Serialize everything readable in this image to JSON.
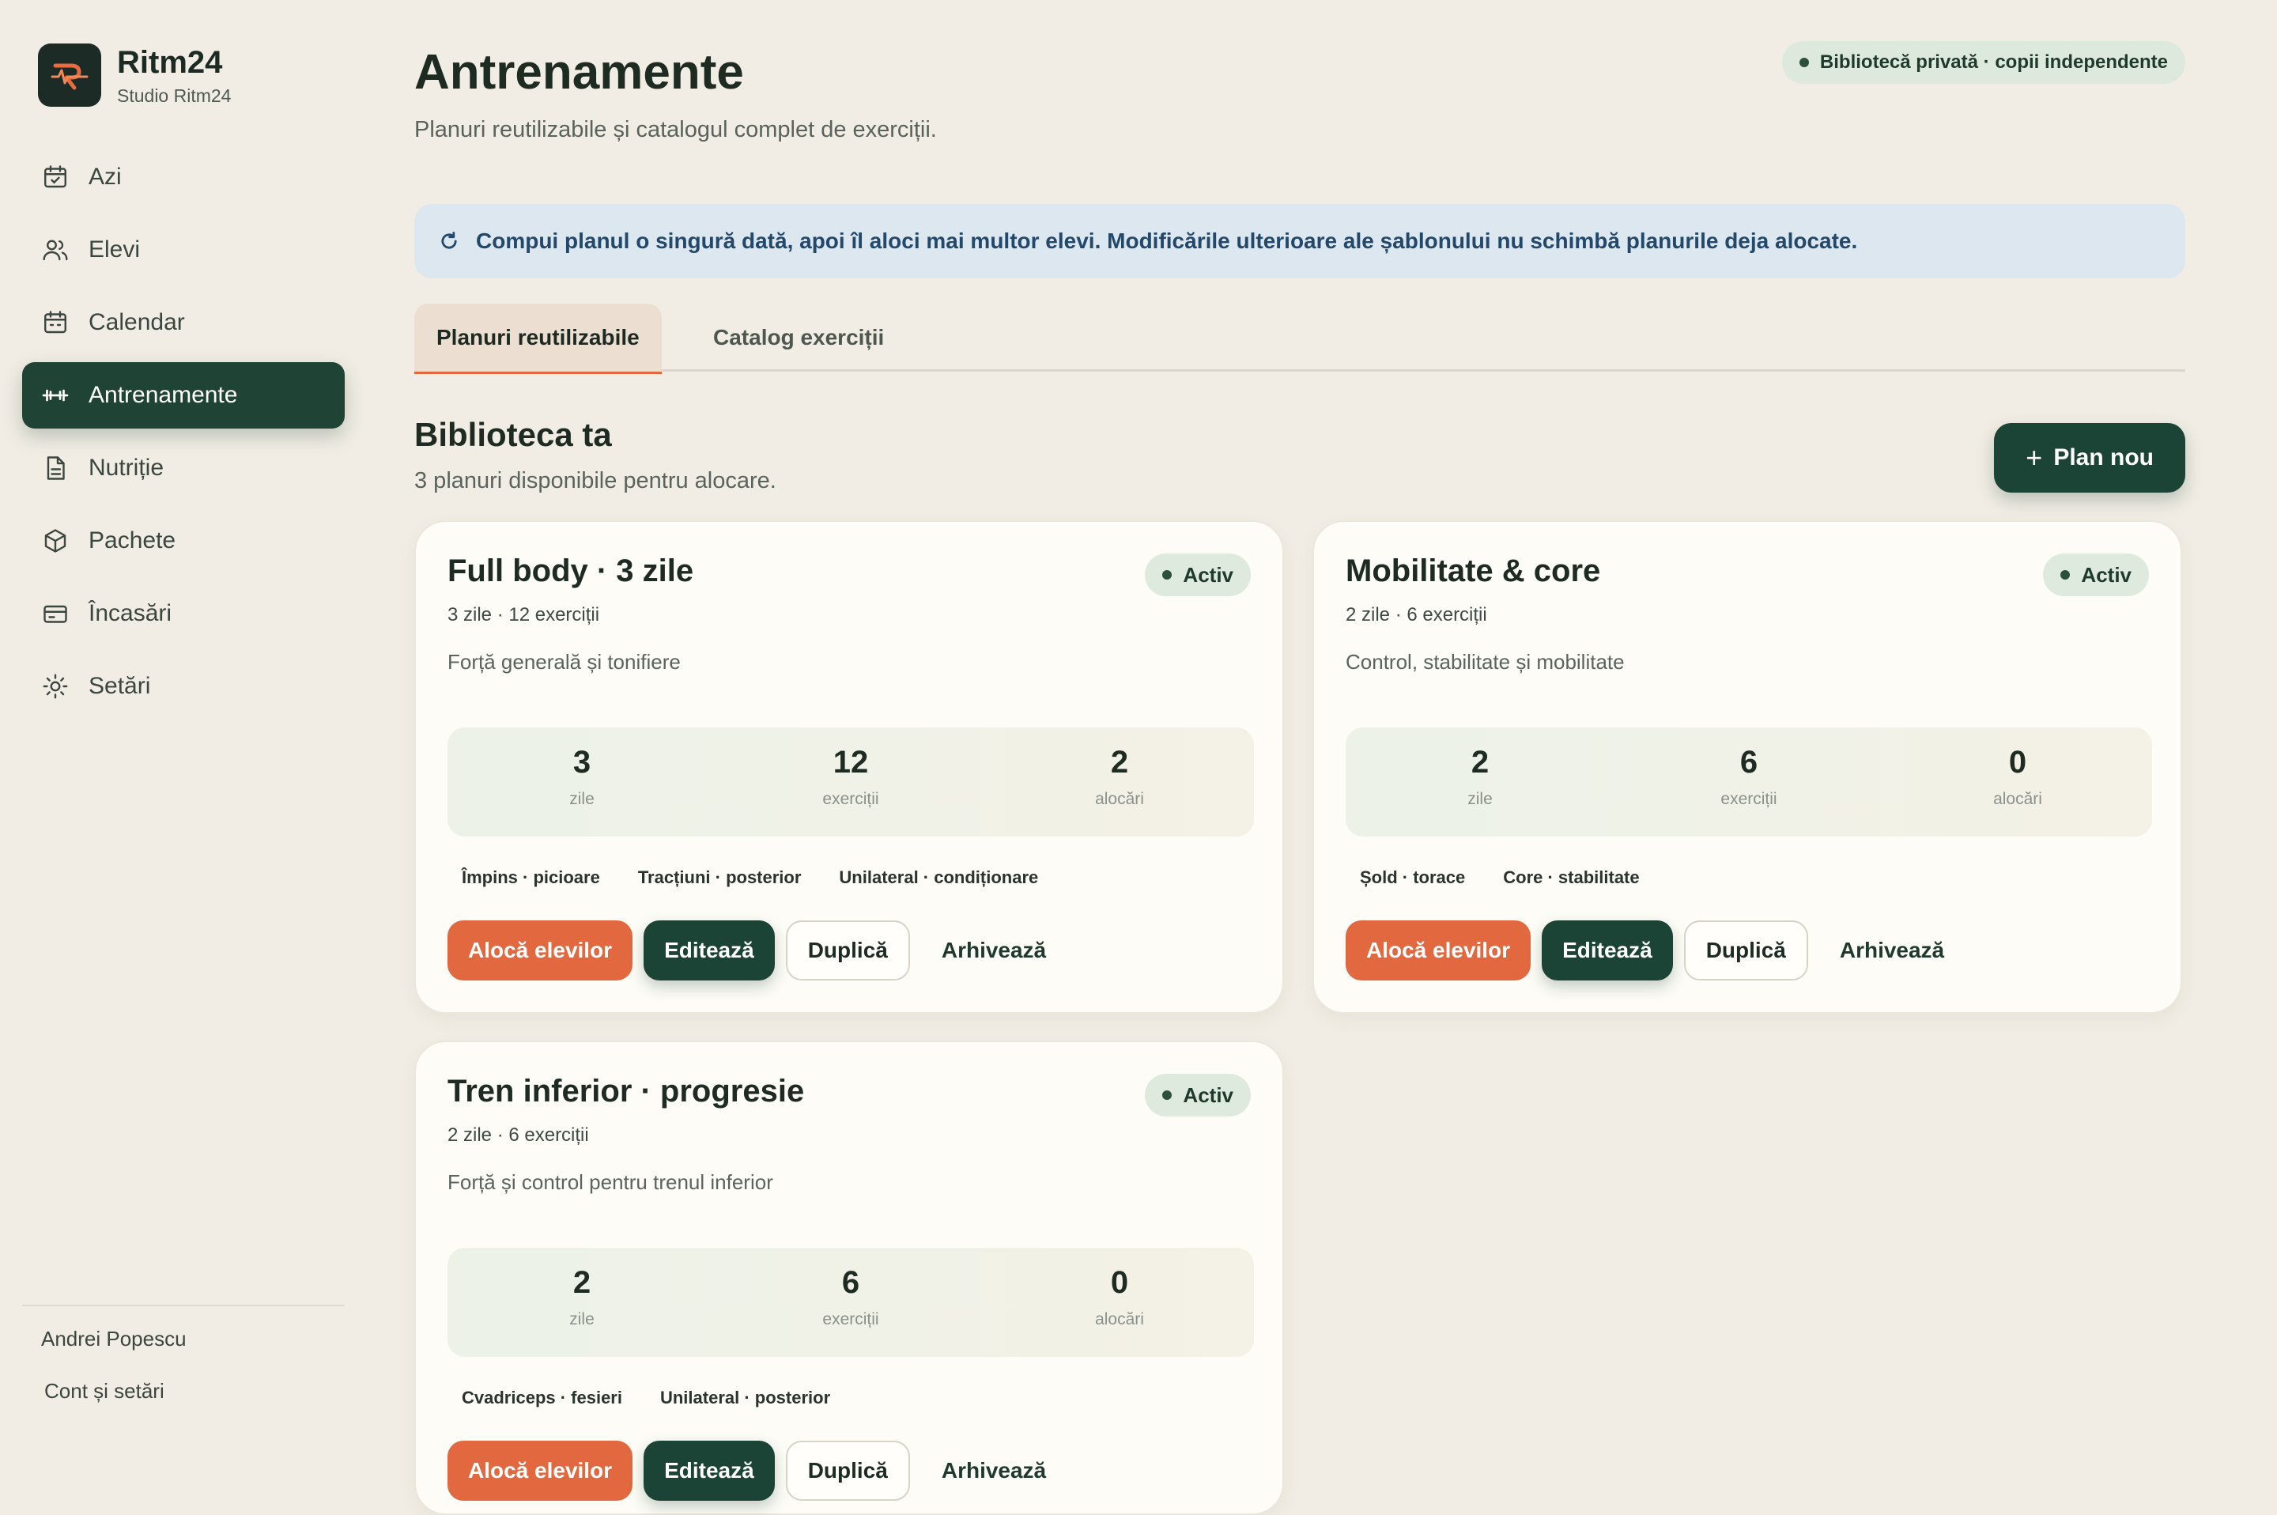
{
  "brand": {
    "name": "Ritm24",
    "subtitle": "Studio Ritm24"
  },
  "nav": [
    {
      "label": "Azi",
      "icon": "calendar-check-icon"
    },
    {
      "label": "Elevi",
      "icon": "users-icon"
    },
    {
      "label": "Calendar",
      "icon": "calendar-icon"
    },
    {
      "label": "Antrenamente",
      "icon": "dumbbell-icon",
      "active": true
    },
    {
      "label": "Nutriție",
      "icon": "document-icon"
    },
    {
      "label": "Pachete",
      "icon": "package-icon"
    },
    {
      "label": "Încasări",
      "icon": "credit-card-icon"
    },
    {
      "label": "Setări",
      "icon": "settings-sun-icon"
    }
  ],
  "user": {
    "name": "Andrei Popescu",
    "account_link": "Cont și setări"
  },
  "page": {
    "title": "Antrenamente",
    "subtitle": "Planuri reutilizabile și catalogul complet de exerciții.",
    "privacy_badge": "Bibliotecă privată · copii independente",
    "info_banner": "Compui planul o singură dată, apoi îl aloci mai multor elevi. Modificările ulterioare ale șablonului nu schimbă planurile deja alocate."
  },
  "tabs": [
    {
      "label": "Planuri reutilizabile",
      "active": true
    },
    {
      "label": "Catalog exerciții",
      "active": false
    }
  ],
  "library": {
    "title": "Biblioteca ta",
    "subtitle": "3 planuri disponibile pentru alocare.",
    "new_plan_label": "Plan nou"
  },
  "plans": [
    {
      "title": "Full body · 3 zile",
      "meta": "3 zile · 12 exerciții",
      "description": "Forță generală și tonifiere",
      "status": "Activ",
      "stats": [
        {
          "value": "3",
          "label": "zile"
        },
        {
          "value": "12",
          "label": "exerciții"
        },
        {
          "value": "2",
          "label": "alocări"
        }
      ],
      "tags": [
        "Împins · picioare",
        "Tracțiuni · posterior",
        "Unilateral · condiționare"
      ]
    },
    {
      "title": "Mobilitate & core",
      "meta": "2 zile · 6 exerciții",
      "description": "Control, stabilitate și mobilitate",
      "status": "Activ",
      "stats": [
        {
          "value": "2",
          "label": "zile"
        },
        {
          "value": "6",
          "label": "exerciții"
        },
        {
          "value": "0",
          "label": "alocări"
        }
      ],
      "tags": [
        "Șold · torace",
        "Core · stabilitate"
      ]
    },
    {
      "title": "Tren inferior · progresie",
      "meta": "2 zile · 6 exerciții",
      "description": "Forță și control pentru trenul inferior",
      "status": "Activ",
      "stats": [
        {
          "value": "2",
          "label": "zile"
        },
        {
          "value": "6",
          "label": "exerciții"
        },
        {
          "value": "0",
          "label": "alocări"
        }
      ],
      "tags": [
        "Cvadriceps · fesieri",
        "Unilateral · posterior"
      ]
    }
  ],
  "actions": {
    "assign": "Alocă elevilor",
    "edit": "Editează",
    "duplicate": "Duplică",
    "archive": "Arhivează"
  },
  "colors": {
    "primary": "#1c4436",
    "accent": "#e2693f",
    "background": "#f1ede4",
    "card": "#fdfcf6",
    "info": "#dde7f0"
  }
}
